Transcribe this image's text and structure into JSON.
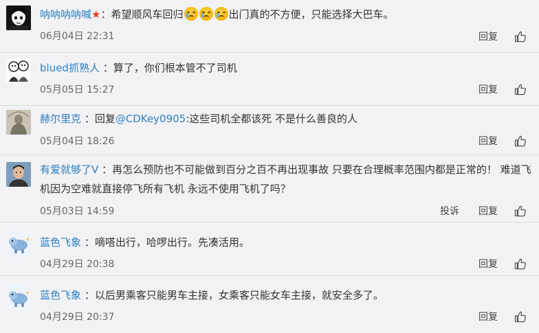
{
  "comments": [
    {
      "username": "呐呐呐呐喊",
      "separator": "：",
      "text_before": "希望顺风车回归",
      "text_after": "出门真的不方便，只能选择大巴车。",
      "timestamp": "06月04日 22:31",
      "reply_label": "回复"
    },
    {
      "username": "blued抓熟人",
      "separator": "：",
      "text": "算了，你们根本管不了司机",
      "timestamp": "05月05日 15:27",
      "reply_label": "回复"
    },
    {
      "username": "赫尔里克",
      "separator": "：",
      "reply_prefix": "回复",
      "mention": "@CDKey0905",
      "text": ":这些司机全都该死 不是什么善良的人",
      "timestamp": "05月04日 18:26",
      "reply_label": "回复"
    },
    {
      "username": "有爱就够了V",
      "separator": "：",
      "text_line1": "再怎么预防也不可能做到百分之百不再出现事故 只要在合理概率范围内都是正常的！ 难道飞",
      "text_line2": "机因为空难就直接停飞所有飞机 永远不使用飞机了吗？",
      "timestamp": "05月03日 14:59",
      "report_label": "投诉",
      "reply_label": "回复"
    },
    {
      "username": "蓝色飞象",
      "separator": "：",
      "text": "嘀嗒出行，哈啰出行。先凑活用。",
      "timestamp": "04月29日 20:38",
      "reply_label": "回复"
    },
    {
      "username": "蓝色飞象",
      "separator": "：",
      "text": "以后男乘客只能男车主接，女乘客只能女车主接，就安全多了。",
      "timestamp": "04月29日 20:37",
      "reply_label": "回复"
    }
  ],
  "colors": {
    "username": "#2e7fc1",
    "background": "#f2f2f5",
    "star": "#e83b1e"
  },
  "icons": {
    "like": "thumbs-up-icon",
    "verified": "star-icon",
    "emoji": "crying-face-icon"
  }
}
